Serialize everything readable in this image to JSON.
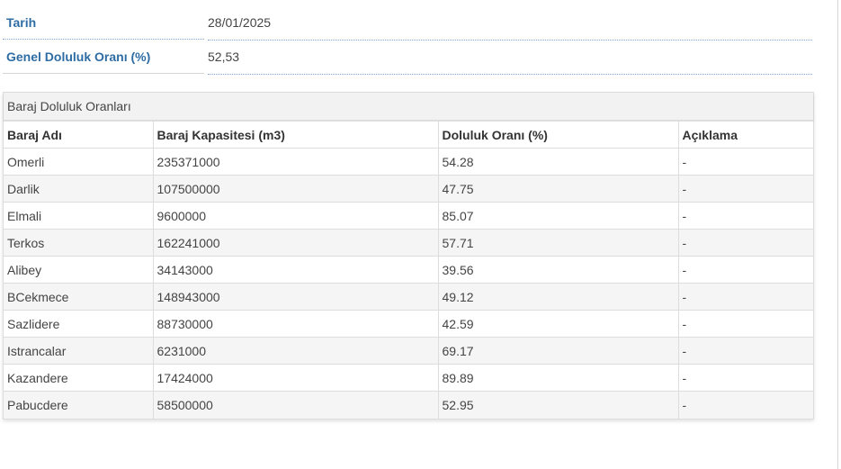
{
  "info": {
    "date_label": "Tarih",
    "date_value": "28/01/2025",
    "overall_label": "Genel Doluluk Oranı (%)",
    "overall_value": "52,53"
  },
  "panel": {
    "title": "Baraj Doluluk Oranları"
  },
  "table": {
    "headers": [
      "Baraj Adı",
      "Baraj Kapasitesi (m3)",
      "Doluluk Oranı (%)",
      "Açıklama"
    ],
    "rows": [
      [
        "Omerli",
        "235371000",
        "54.28",
        "-"
      ],
      [
        "Darlik",
        "107500000",
        "47.75",
        "-"
      ],
      [
        "Elmali",
        "9600000",
        "85.07",
        "-"
      ],
      [
        "Terkos",
        "162241000",
        "57.71",
        "-"
      ],
      [
        "Alibey",
        "34143000",
        "39.56",
        "-"
      ],
      [
        "BCekmece",
        "148943000",
        "49.12",
        "-"
      ],
      [
        "Sazlidere",
        "88730000",
        "42.59",
        "-"
      ],
      [
        "Istrancalar",
        "6231000",
        "69.17",
        "-"
      ],
      [
        "Kazandere",
        "17424000",
        "89.89",
        "-"
      ],
      [
        "Pabucdere",
        "58500000",
        "52.95",
        "-"
      ]
    ]
  },
  "colors": {
    "label_blue": "#2e6da4",
    "row_stripe": "#f5f5f5",
    "panel_heading_bg": "#f2f2f2"
  }
}
